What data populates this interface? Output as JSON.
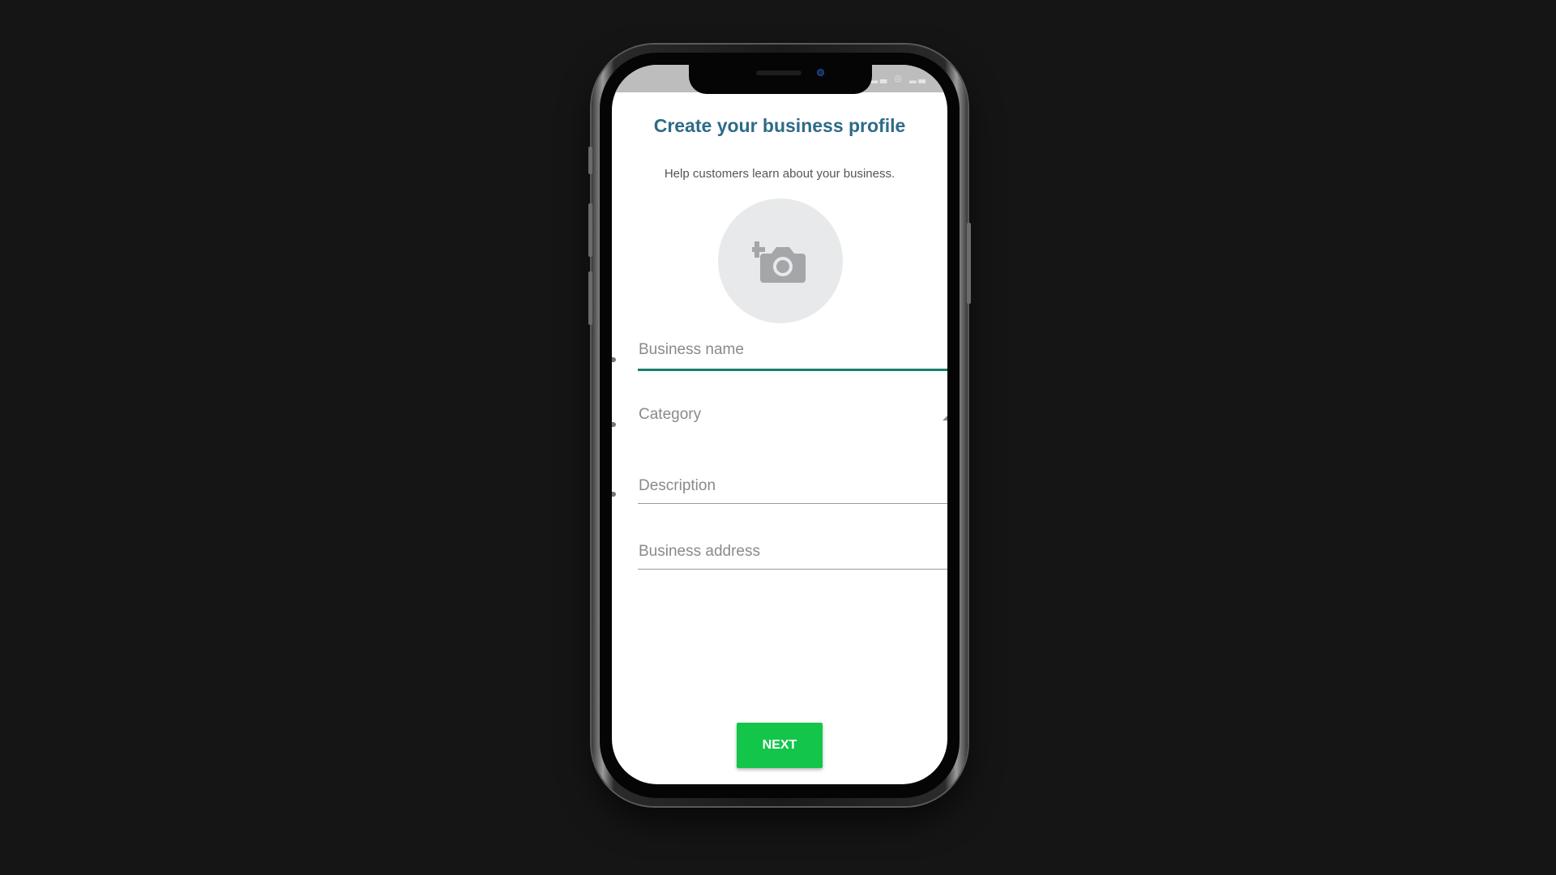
{
  "screen": {
    "title": "Create your business profile",
    "subtitle": "Help customers learn about your business.",
    "photo_icon": "add-camera-icon"
  },
  "form": {
    "business_name_placeholder": "Business name",
    "category_placeholder": "Category",
    "description_placeholder": "Description",
    "business_address_placeholder": "Business address"
  },
  "actions": {
    "next_label": "NEXT"
  },
  "colors": {
    "title": "#2e6a88",
    "accent_underline": "#1a7f6b",
    "next_button": "#13c64a",
    "background": "#151515"
  }
}
